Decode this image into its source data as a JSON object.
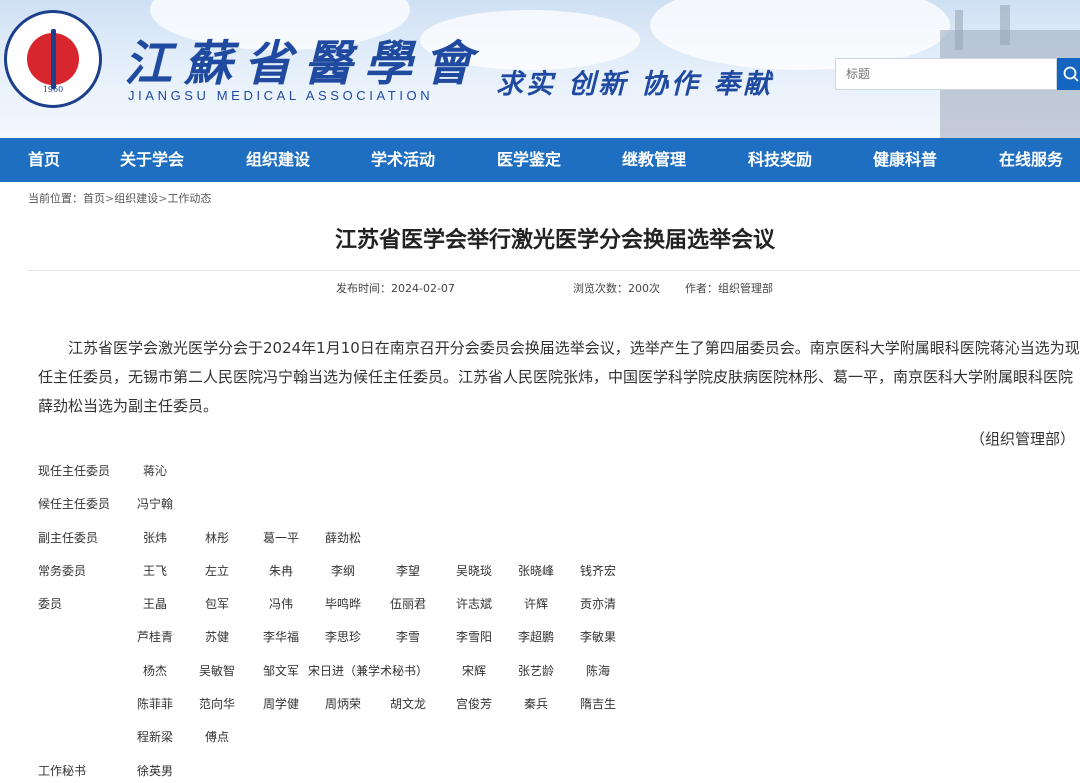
{
  "header": {
    "logo_year": "1960",
    "brand_cn": "江蘇省醫學會",
    "brand_en": "JIANGSU MEDICAL ASSOCIATION",
    "slogan": "求实 创新 协作 奉献",
    "search_placeholder": "标题"
  },
  "nav": [
    "首页",
    "关于学会",
    "组织建设",
    "学术活动",
    "医学鉴定",
    "继教管理",
    "科技奖励",
    "健康科普",
    "在线服务"
  ],
  "breadcrumb": {
    "prefix": "当前位置：",
    "items": [
      "首页",
      "组织建设",
      "工作动态"
    ],
    "sep": ">"
  },
  "article": {
    "title": "江苏省医学会举行激光医学分会换届选举会议",
    "publish": "发布时间：2024-02-07",
    "views": "浏览次数：200次",
    "author": "作者：组织管理部",
    "body": "江苏省医学会激光医学分会于2024年1月10日在南京召开分会委员会换届选举会议，选举产生了第四届委员会。南京医科大学附属眼科医院蒋沁当选为现任主任委员，无锡市第二人民医院冯宁翰当选为候任主任委员。江苏省人民医院张炜，中国医学科学院皮肤病医院林彤、葛一平，南京医科大学附属眼科医院薛劲松当选为副主任委员。",
    "sign": "（组织管理部）"
  },
  "members": [
    {
      "label": "现任主任委员",
      "names": [
        "蒋沁"
      ]
    },
    {
      "label": "候任主任委员",
      "names": [
        "冯宁翰"
      ]
    },
    {
      "label": "副主任委员",
      "names": [
        "张炜",
        "林彤",
        "葛一平",
        "薛劲松"
      ]
    },
    {
      "label": "常务委员",
      "names": [
        "王飞",
        "左立",
        "朱冉",
        "李纲",
        "李望",
        "吴晓琰",
        "张晓峰",
        "钱齐宏"
      ]
    },
    {
      "label": "委员",
      "names": [
        "王晶",
        "包军",
        "冯伟",
        "毕鸣晔",
        "伍丽君",
        "许志斌",
        "许辉",
        "贡亦清"
      ]
    },
    {
      "label": "",
      "names": [
        "芦桂青",
        "苏健",
        "李华福",
        "李思珍",
        "李雪",
        "李雪阳",
        "李超鹏",
        "李敏果"
      ]
    },
    {
      "label": "",
      "names": [
        "杨杰",
        "吴敏智",
        "邹文军",
        "宋日进（兼学术秘书）",
        "宋辉",
        "张艺龄",
        "陈海"
      ]
    },
    {
      "label": "",
      "names": [
        "陈菲菲",
        "范向华",
        "周学健",
        "周炳荣",
        "胡文龙",
        "宫俊芳",
        "秦兵",
        "隋吉生"
      ]
    },
    {
      "label": "",
      "names": [
        "程新梁",
        "傅点"
      ]
    },
    {
      "label": "工作秘书",
      "names": [
        "徐英男"
      ]
    }
  ]
}
